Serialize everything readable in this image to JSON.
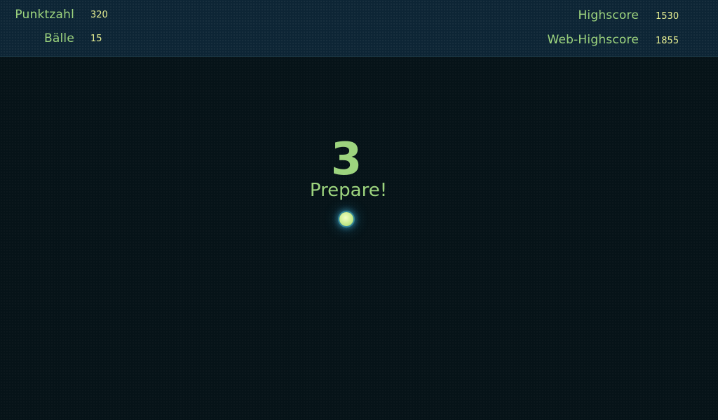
{
  "hud": {
    "score_label": "Punktzahl",
    "score_value": "320",
    "balls_label": "Bälle",
    "balls_value": "15",
    "highscore_label": "Highscore",
    "highscore_value": "1530",
    "web_highscore_label": "Web-Highscore",
    "web_highscore_value": "1855"
  },
  "playfield": {
    "countdown": "3",
    "status": "Prepare!"
  },
  "colors": {
    "background": "#061318",
    "hud_background": "#0d2535",
    "label": "#9dd47e",
    "value": "#e7ef92",
    "ball": "#c8ec8e",
    "ball_glow": "#3caac8"
  },
  "icons": {
    "ball": "ball-icon"
  }
}
